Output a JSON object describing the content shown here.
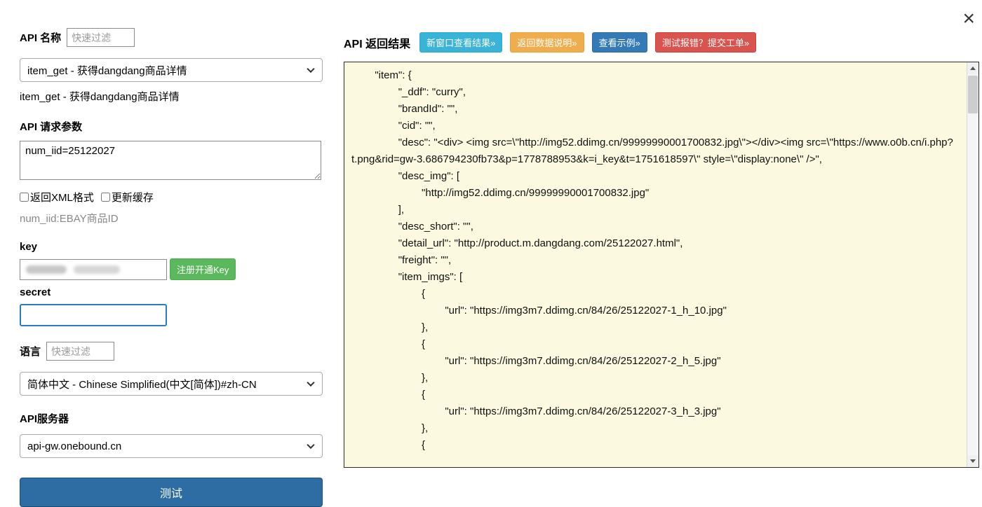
{
  "window": {
    "close_icon": "×"
  },
  "left": {
    "api_name_label": "API 名称",
    "filter_placeholder": "快速过滤",
    "api_select_value": "item_get - 获得dangdang商品详情",
    "api_caption": "item_get - 获得dangdang商品详情",
    "request_params_label": "API 请求参数",
    "params_value": "num_iid=25122027",
    "xml_checkbox_label": "返回XML格式",
    "cache_checkbox_label": "更新缓存",
    "param_hint": "num_iid:EBAY商品ID",
    "key_label": "key",
    "register_key_button": "注册开通Key",
    "secret_label": "secret",
    "language_label": "语言",
    "language_select_value": "简体中文 - Chinese Simplified(中文[简体])#zh-CN",
    "api_server_label": "API服务器",
    "api_server_value": "api-gw.onebound.cn",
    "test_button": "测试"
  },
  "right": {
    "title": "API 返回结果",
    "buttons": [
      {
        "label": "新窗口查看结果»",
        "color": "#39b3d7"
      },
      {
        "label": "返回数据说明»",
        "color": "#f0ad4e"
      },
      {
        "label": "查看示例»",
        "color": "#337ab7"
      },
      {
        "label": "测试报错？提交工单»",
        "color": "#d9534f"
      }
    ],
    "result_bg_color": "#fbfae1",
    "result_json": "        \"item\": {\n                \"_ddf\": \"curry\",\n                \"brandId\": \"\",\n                \"cid\": \"\",\n                \"desc\": \"<div> <img src=\\\"http://img52.ddimg.cn/99999990001700832.jpg\\\"></div><img src=\\\"https://www.o0b.cn/i.php?t.png&rid=gw-3.686794230fb73&p=1778788953&k=i_key&t=1751618597\\\" style=\\\"display:none\\\" />\",\n                \"desc_img\": [\n                        \"http://img52.ddimg.cn/99999990001700832.jpg\"\n                ],\n                \"desc_short\": \"\",\n                \"detail_url\": \"http://product.m.dangdang.com/25122027.html\",\n                \"freight\": \"\",\n                \"item_imgs\": [\n                        {\n                                \"url\": \"https://img3m7.ddimg.cn/84/26/25122027-1_h_10.jpg\"\n                        },\n                        {\n                                \"url\": \"https://img3m7.ddimg.cn/84/26/25122027-2_h_5.jpg\"\n                        },\n                        {\n                                \"url\": \"https://img3m7.ddimg.cn/84/26/25122027-3_h_3.jpg\"\n                        },\n                        {"
  }
}
